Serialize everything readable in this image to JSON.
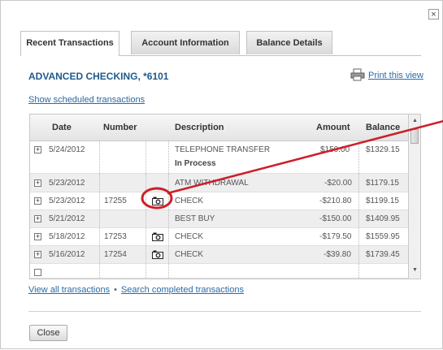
{
  "dialog": {
    "close_symbol": "×",
    "tabs": [
      {
        "label": "Recent Transactions",
        "active": true
      },
      {
        "label": "Account Information",
        "active": false
      },
      {
        "label": "Balance Details",
        "active": false
      }
    ],
    "account_title": "ADVANCED CHECKING, *6101",
    "print_link": "Print this view",
    "show_scheduled_link": "Show scheduled transactions",
    "table": {
      "headers": {
        "date": "Date",
        "number": "Number",
        "description": "Description",
        "amount": "Amount",
        "balance": "Balance"
      },
      "rows": [
        {
          "date": "5/24/2012",
          "number": "",
          "has_image": false,
          "description": "TELEPHONE TRANSFER",
          "status": "In Process",
          "amount": "$150.00",
          "balance": "$1329.15"
        },
        {
          "date": "5/23/2012",
          "number": "",
          "has_image": false,
          "description": "ATM WITHDRAWAL",
          "status": "",
          "amount": "-$20.00",
          "balance": "$1179.15"
        },
        {
          "date": "5/23/2012",
          "number": "17255",
          "has_image": true,
          "description": "CHECK",
          "status": "",
          "amount": "-$210.80",
          "balance": "$1199.15"
        },
        {
          "date": "5/21/2012",
          "number": "",
          "has_image": false,
          "description": "BEST BUY",
          "status": "",
          "amount": "-$150.00",
          "balance": "$1409.95"
        },
        {
          "date": "5/18/2012",
          "number": "17253",
          "has_image": true,
          "description": "CHECK",
          "status": "",
          "amount": "-$179.50",
          "balance": "$1559.95"
        },
        {
          "date": "5/16/2012",
          "number": "17254",
          "has_image": true,
          "description": "CHECK",
          "status": "",
          "amount": "-$39.80",
          "balance": "$1739.45"
        }
      ]
    },
    "view_all_link": "View all transactions",
    "separator": "•",
    "search_link": "Search completed transactions",
    "close_button": "Close"
  },
  "icons": {
    "print": "printer-icon",
    "expand": "plus-icon",
    "check_image": "camera-icon"
  },
  "colors": {
    "link": "#2a6aa6",
    "title": "#1f5a8c",
    "annotation": "#cc1f2a"
  }
}
